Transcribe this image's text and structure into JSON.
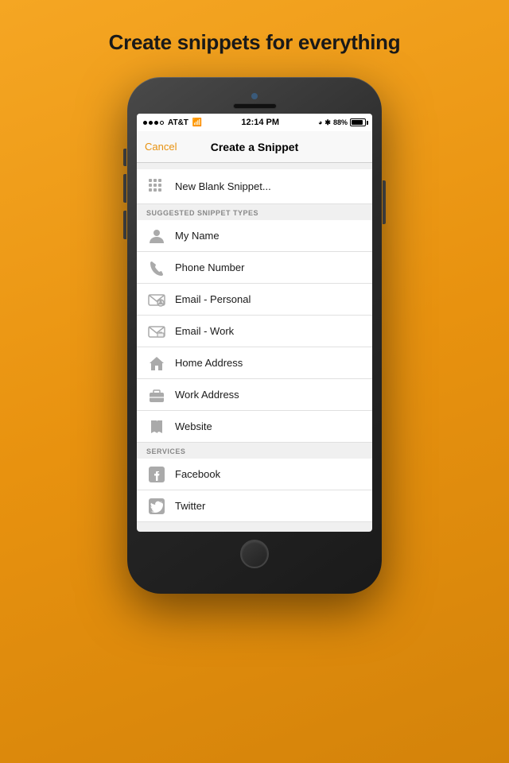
{
  "page": {
    "title": "Create snippets for everything"
  },
  "status_bar": {
    "carrier": "AT&T",
    "wifi": "WiFi",
    "time": "12:14 PM",
    "battery": "88%"
  },
  "nav": {
    "cancel_label": "Cancel",
    "title": "Create a Snippet"
  },
  "new_blank": {
    "label": "New Blank Snippet..."
  },
  "suggested_section": {
    "header": "SUGGESTED SNIPPET TYPES",
    "items": [
      {
        "id": "my-name",
        "label": "My Name",
        "icon": "person"
      },
      {
        "id": "phone-number",
        "label": "Phone Number",
        "icon": "phone"
      },
      {
        "id": "email-personal",
        "label": "Email - Personal",
        "icon": "email-person"
      },
      {
        "id": "email-work",
        "label": "Email - Work",
        "icon": "email-work"
      },
      {
        "id": "home-address",
        "label": "Home Address",
        "icon": "home"
      },
      {
        "id": "work-address",
        "label": "Work Address",
        "icon": "briefcase"
      },
      {
        "id": "website",
        "label": "Website",
        "icon": "book"
      }
    ]
  },
  "services_section": {
    "header": "SERVICES",
    "items": [
      {
        "id": "facebook",
        "label": "Facebook",
        "icon": "facebook"
      },
      {
        "id": "twitter",
        "label": "Twitter",
        "icon": "twitter"
      }
    ]
  }
}
